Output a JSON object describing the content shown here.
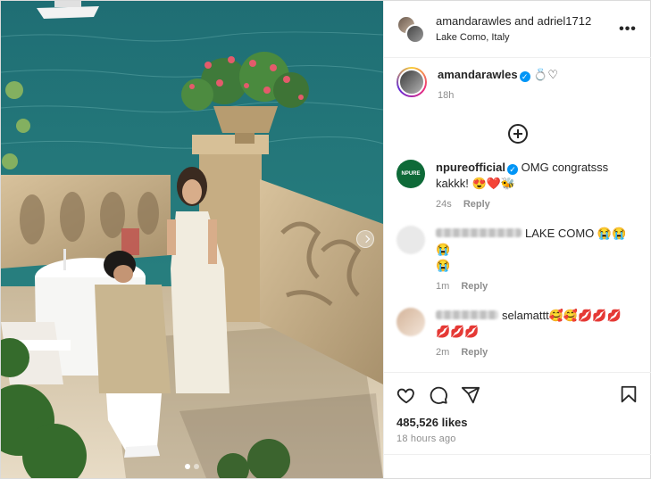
{
  "header": {
    "users": "amandarawles and adriel1712",
    "location": "Lake Como, Italy",
    "more_label": "•••"
  },
  "caption": {
    "username": "amandarawles",
    "text": "💍♡",
    "time": "18h"
  },
  "comments": [
    {
      "username": "npureofficial",
      "verified": true,
      "text": "OMG congratsss kakkk! 😍❤️🐝",
      "time": "24s",
      "reply_label": "Reply",
      "avatar_text": "NPURE"
    },
    {
      "username": "",
      "text": "LAKE COMO 😭😭😭",
      "extra": "😭",
      "time": "1m",
      "reply_label": "Reply"
    },
    {
      "username": "",
      "text": "selamattt🥰🥰💋💋💋",
      "extra": "💋💋💋",
      "time": "2m",
      "reply_label": "Reply"
    }
  ],
  "footer": {
    "likes": "485,526 likes",
    "time_ago": "18 hours ago"
  },
  "colors": {
    "verified": "#0095f6",
    "muted": "#8e8e8e",
    "text": "#262626"
  },
  "icons": [
    "heart-icon",
    "comment-icon",
    "share-icon",
    "bookmark-icon",
    "add-circle-icon",
    "more-icon",
    "next-arrow-icon"
  ]
}
